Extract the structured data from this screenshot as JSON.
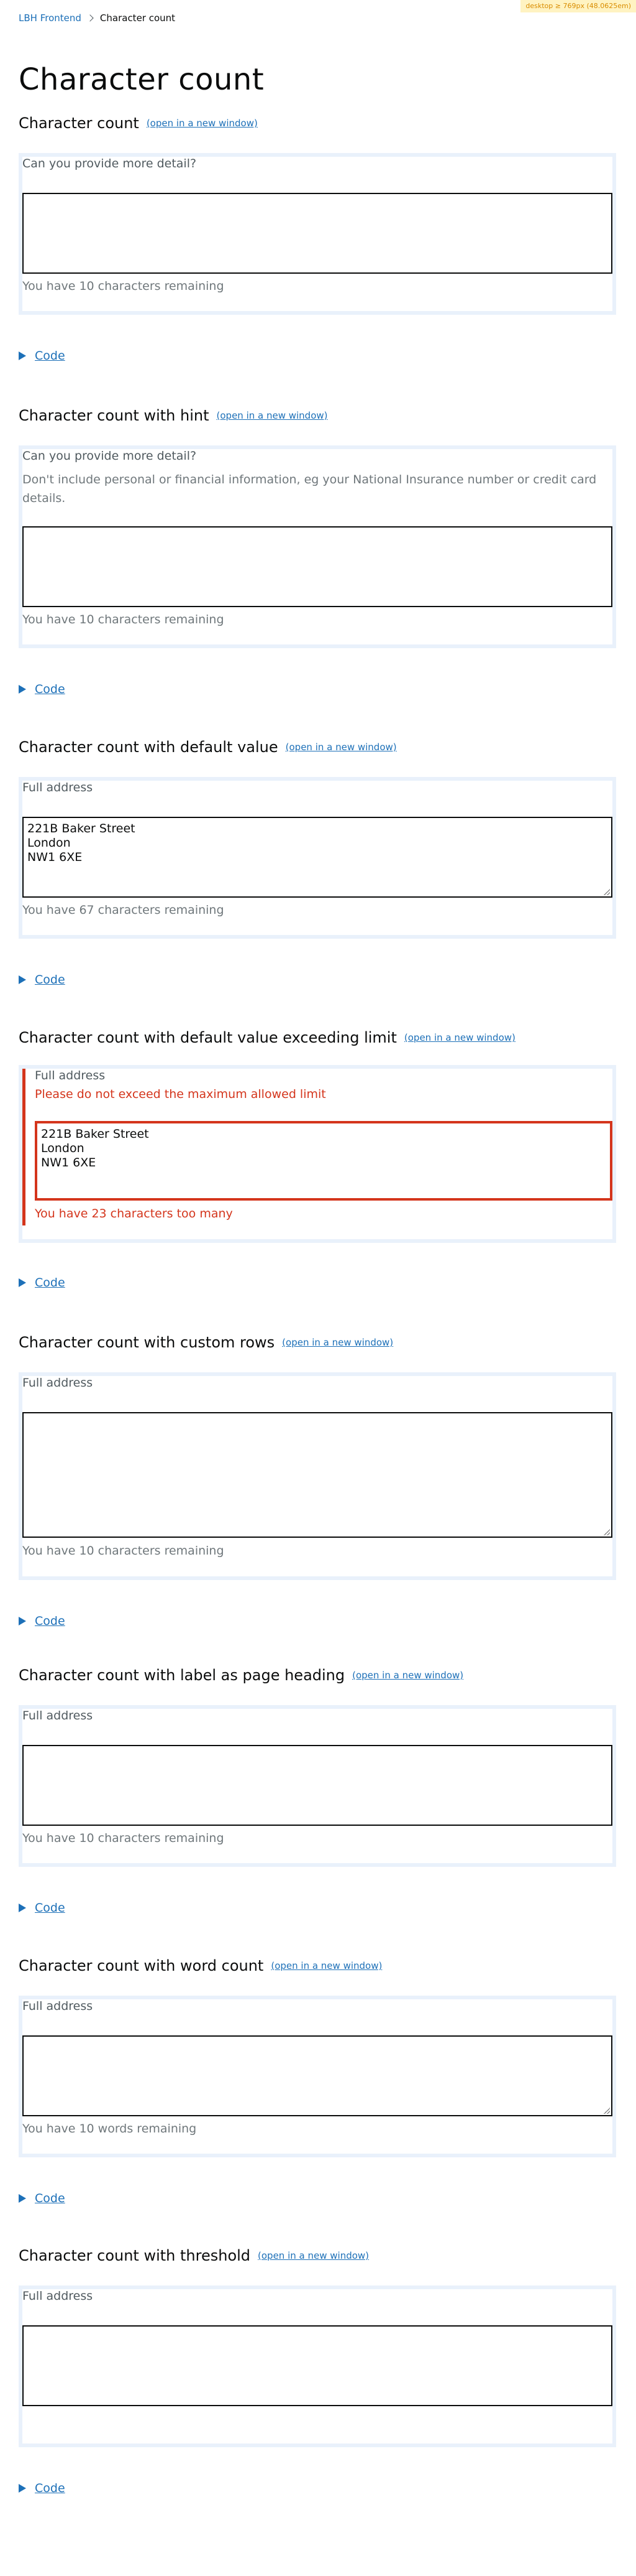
{
  "badge": "desktop ≥ 769px (48.0625em)",
  "breadcrumb": {
    "home": "LBH Frontend",
    "current": "Character count"
  },
  "page_title": "Character count",
  "new_window": "(open in a new window)",
  "code_label": "Code",
  "examples": [
    {
      "heading": "Character count",
      "label": "Can you provide more detail?",
      "value": "",
      "message": "You have 10 characters remaining"
    },
    {
      "heading": "Character count with hint",
      "label": "Can you provide more detail?",
      "hint": "Don't include personal or financial information, eg your National Insurance number or credit card details.",
      "value": "",
      "message": "You have 10 characters remaining"
    },
    {
      "heading": "Character count with default value",
      "label": "Full address",
      "value": "221B Baker Street\nLondon\nNW1 6XE",
      "message": "You have 67 characters remaining"
    },
    {
      "heading": "Character count with default value exceeding limit",
      "label": "Full address",
      "error": "Please do not exceed the maximum allowed limit",
      "value": "221B Baker Street\nLondon\nNW1 6XE",
      "message": "You have 23 characters too many"
    },
    {
      "heading": "Character count with custom rows",
      "label": "Full address",
      "value": "",
      "message": "You have 10 characters remaining"
    },
    {
      "heading": "Character count with label as page heading",
      "label": "Full address",
      "value": "",
      "message": "You have 10 characters remaining"
    },
    {
      "heading": "Character count with word count",
      "label": "Full address",
      "value": "",
      "message": "You have 10 words remaining"
    },
    {
      "heading": "Character count with threshold",
      "label": "Full address",
      "value": "",
      "message": ""
    }
  ],
  "colors": {
    "link": "#1d70b8",
    "error": "#d4351c",
    "frame": "#e9f1fb",
    "text": "#0b0c0c"
  }
}
